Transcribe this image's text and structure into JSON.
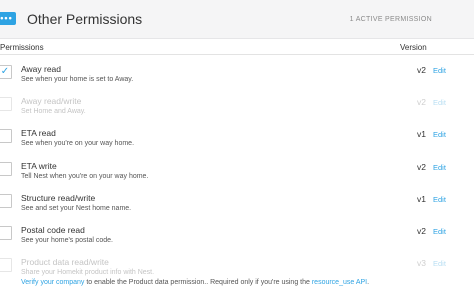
{
  "header": {
    "title": "Other Permissions",
    "count": "1 ACTIVE PERMISSION",
    "icon": "more-icon",
    "collapse_icon": "chevron-up-icon",
    "accent": "#2ea3e3"
  },
  "columns": {
    "permissions": "Permissions",
    "version": "Version"
  },
  "permissions": [
    {
      "name": "Away read",
      "description": "See when your home is set to Away.",
      "version": "v2",
      "edit": "Edit",
      "checked": true,
      "disabled": false
    },
    {
      "name": "Away read/write",
      "description": "Set Home and Away.",
      "version": "v2",
      "edit": "Edit",
      "checked": false,
      "disabled": true
    },
    {
      "name": "ETA read",
      "description": "See when you're on your way home.",
      "version": "v1",
      "edit": "Edit",
      "checked": false,
      "disabled": false
    },
    {
      "name": "ETA write",
      "description": "Tell Nest when you're on your way home.",
      "version": "v2",
      "edit": "Edit",
      "checked": false,
      "disabled": false
    },
    {
      "name": "Structure read/write",
      "description": "See and set your Nest home name.",
      "version": "v1",
      "edit": "Edit",
      "checked": false,
      "disabled": false
    },
    {
      "name": "Postal code read",
      "description": "See your home's postal code.",
      "version": "v2",
      "edit": "Edit",
      "checked": false,
      "disabled": false
    },
    {
      "name": "Product data read/write",
      "description": "Share your Homekit product info with Nest.",
      "version": "v3",
      "edit": "Edit",
      "checked": false,
      "disabled": true
    }
  ],
  "footer": {
    "link1": "Verify your company",
    "text1": " to enable the Product data permission.. Required only if you're using the ",
    "link2": "resource_use API",
    "text2": "."
  }
}
